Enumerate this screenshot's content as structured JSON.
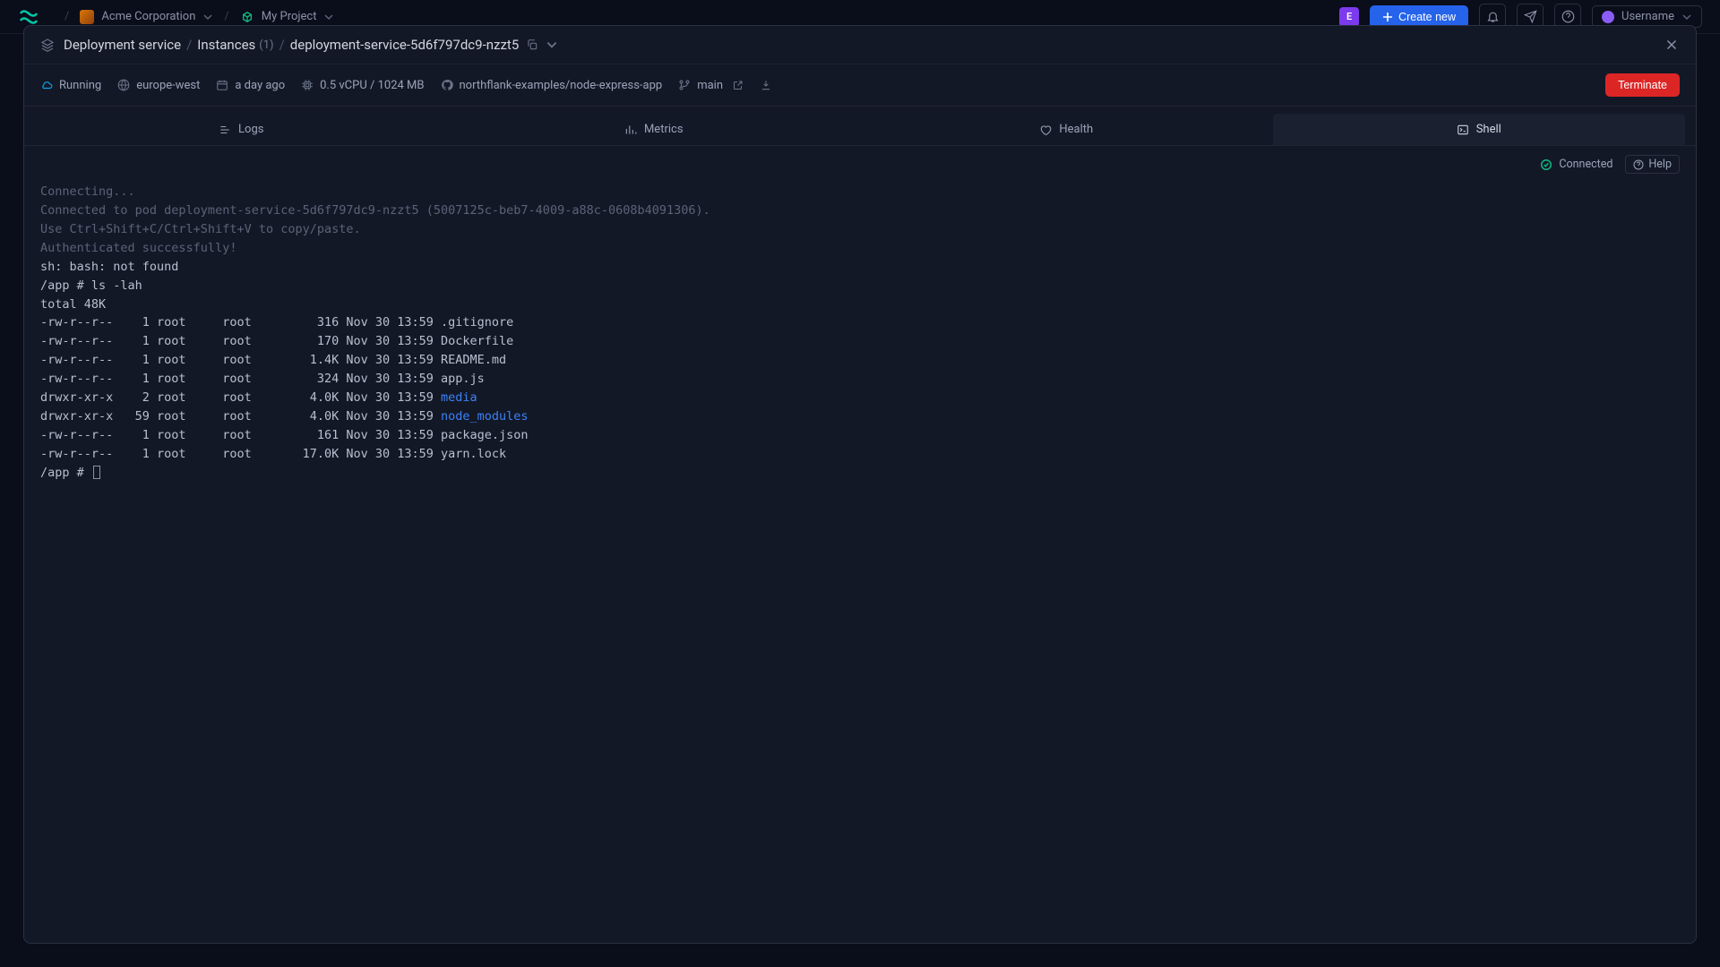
{
  "topbar": {
    "org": "Acme Corporation",
    "project": "My Project",
    "create_label": "Create new",
    "username": "Username",
    "avatar_letter": "E"
  },
  "breadcrumb": {
    "service": "Deployment service",
    "instances": "Instances",
    "instances_count": "(1)",
    "instance_id": "deployment-service-5d6f797dc9-nzzt5"
  },
  "meta": {
    "status": "Running",
    "region": "europe-west",
    "age": "a day ago",
    "resources": "0.5 vCPU / 1024 MB",
    "repo": "northflank-examples/node-express-app",
    "branch": "main",
    "terminate_label": "Terminate"
  },
  "tabs": {
    "logs": "Logs",
    "metrics": "Metrics",
    "health": "Health",
    "shell": "Shell"
  },
  "term_status": {
    "connected": "Connected",
    "help": "Help"
  },
  "terminal": {
    "lines": [
      {
        "cls": "term-dim",
        "text": "Connecting..."
      },
      {
        "cls": "term-dim",
        "text": "Connected to pod deployment-service-5d6f797dc9-nzzt5 (5007125c-beb7-4009-a88c-0608b4091306)."
      },
      {
        "cls": "term-dim",
        "text": "Use Ctrl+Shift+C/Ctrl+Shift+V to copy/paste."
      },
      {
        "cls": "term-dim",
        "text": "Authenticated successfully!"
      },
      {
        "cls": "",
        "text": "sh: bash: not found"
      },
      {
        "cls": "",
        "text": "/app # ls -lah"
      },
      {
        "cls": "",
        "text": "total 48K"
      },
      {
        "cls": "",
        "text": "-rw-r--r--    1 root     root         316 Nov 30 13:59 .gitignore"
      },
      {
        "cls": "",
        "text": "-rw-r--r--    1 root     root         170 Nov 30 13:59 Dockerfile"
      },
      {
        "cls": "",
        "text": "-rw-r--r--    1 root     root        1.4K Nov 30 13:59 README.md"
      },
      {
        "cls": "",
        "text": "-rw-r--r--    1 root     root         324 Nov 30 13:59 app.js"
      },
      {
        "cls": "row-dir",
        "pre": "drwxr-xr-x    2 root     root        4.0K Nov 30 13:59 ",
        "dir": "media"
      },
      {
        "cls": "row-dir",
        "pre": "drwxr-xr-x   59 root     root        4.0K Nov 30 13:59 ",
        "dir": "node_modules"
      },
      {
        "cls": "",
        "text": "-rw-r--r--    1 root     root         161 Nov 30 13:59 package.json"
      },
      {
        "cls": "",
        "text": "-rw-r--r--    1 root     root       17.0K Nov 30 13:59 yarn.lock"
      }
    ],
    "prompt": "/app # "
  }
}
